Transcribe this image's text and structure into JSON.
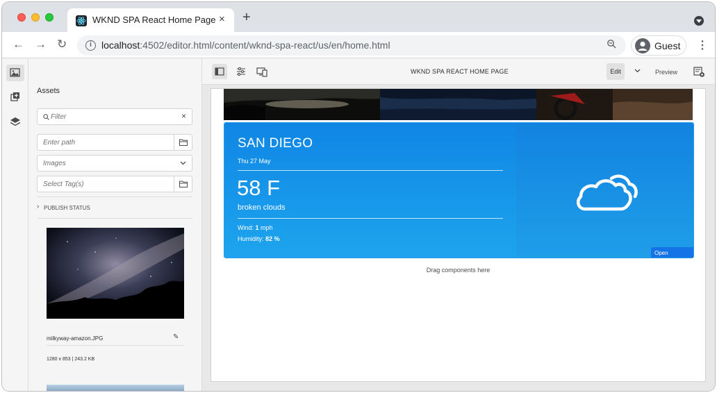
{
  "browser": {
    "tab_title": "WKND SPA React Home Page",
    "tab_close": "×",
    "new_tab": "+",
    "url_host": "localhost",
    "url_rest": ":4502/editor.html/content/wknd-spa-react/us/en/home.html",
    "guest_label": "Guest",
    "back": "←",
    "forward": "→",
    "reload": "↻",
    "menu": "⋮",
    "info_glyph": "i"
  },
  "editor": {
    "page_title": "WKND SPA REACT HOME PAGE",
    "edit_label": "Edit",
    "preview_label": "Preview",
    "mode_chevron": "⌄",
    "icons": [
      "toggle-side-panel-icon",
      "page-properties-icon",
      "emulator-icon",
      "annotations-icon"
    ]
  },
  "side_panel": {
    "title": "Assets",
    "filter_placeholder": "Filter",
    "filter_clear": "×",
    "path_placeholder": "Enter path",
    "type_value": "Images",
    "tag_placeholder": "Select Tag(s)",
    "publish_status": "PUBLISH STATUS",
    "publish_chevron": "›",
    "asset": {
      "name": "milkyway-amazon.JPG",
      "meta": "1280 x 853 | 243.2 KB",
      "edit_glyph": "✎"
    }
  },
  "rail": {
    "icons": [
      "assets-icon",
      "components-icon",
      "content-tree-icon"
    ]
  },
  "weather": {
    "city": "SAN DIEGO",
    "date": "Thu 27 May",
    "temperature": "58 F",
    "description": "broken clouds",
    "wind_label": "Wind: ",
    "wind_value": "1",
    "wind_unit": " mph",
    "humidity_label": "Humidity: ",
    "humidity_value": "82 %",
    "badge": "Open Weather",
    "colors": {
      "panel": "#0f86e4",
      "badge": "#1473e6"
    }
  },
  "drop_zone": "Drag components here"
}
